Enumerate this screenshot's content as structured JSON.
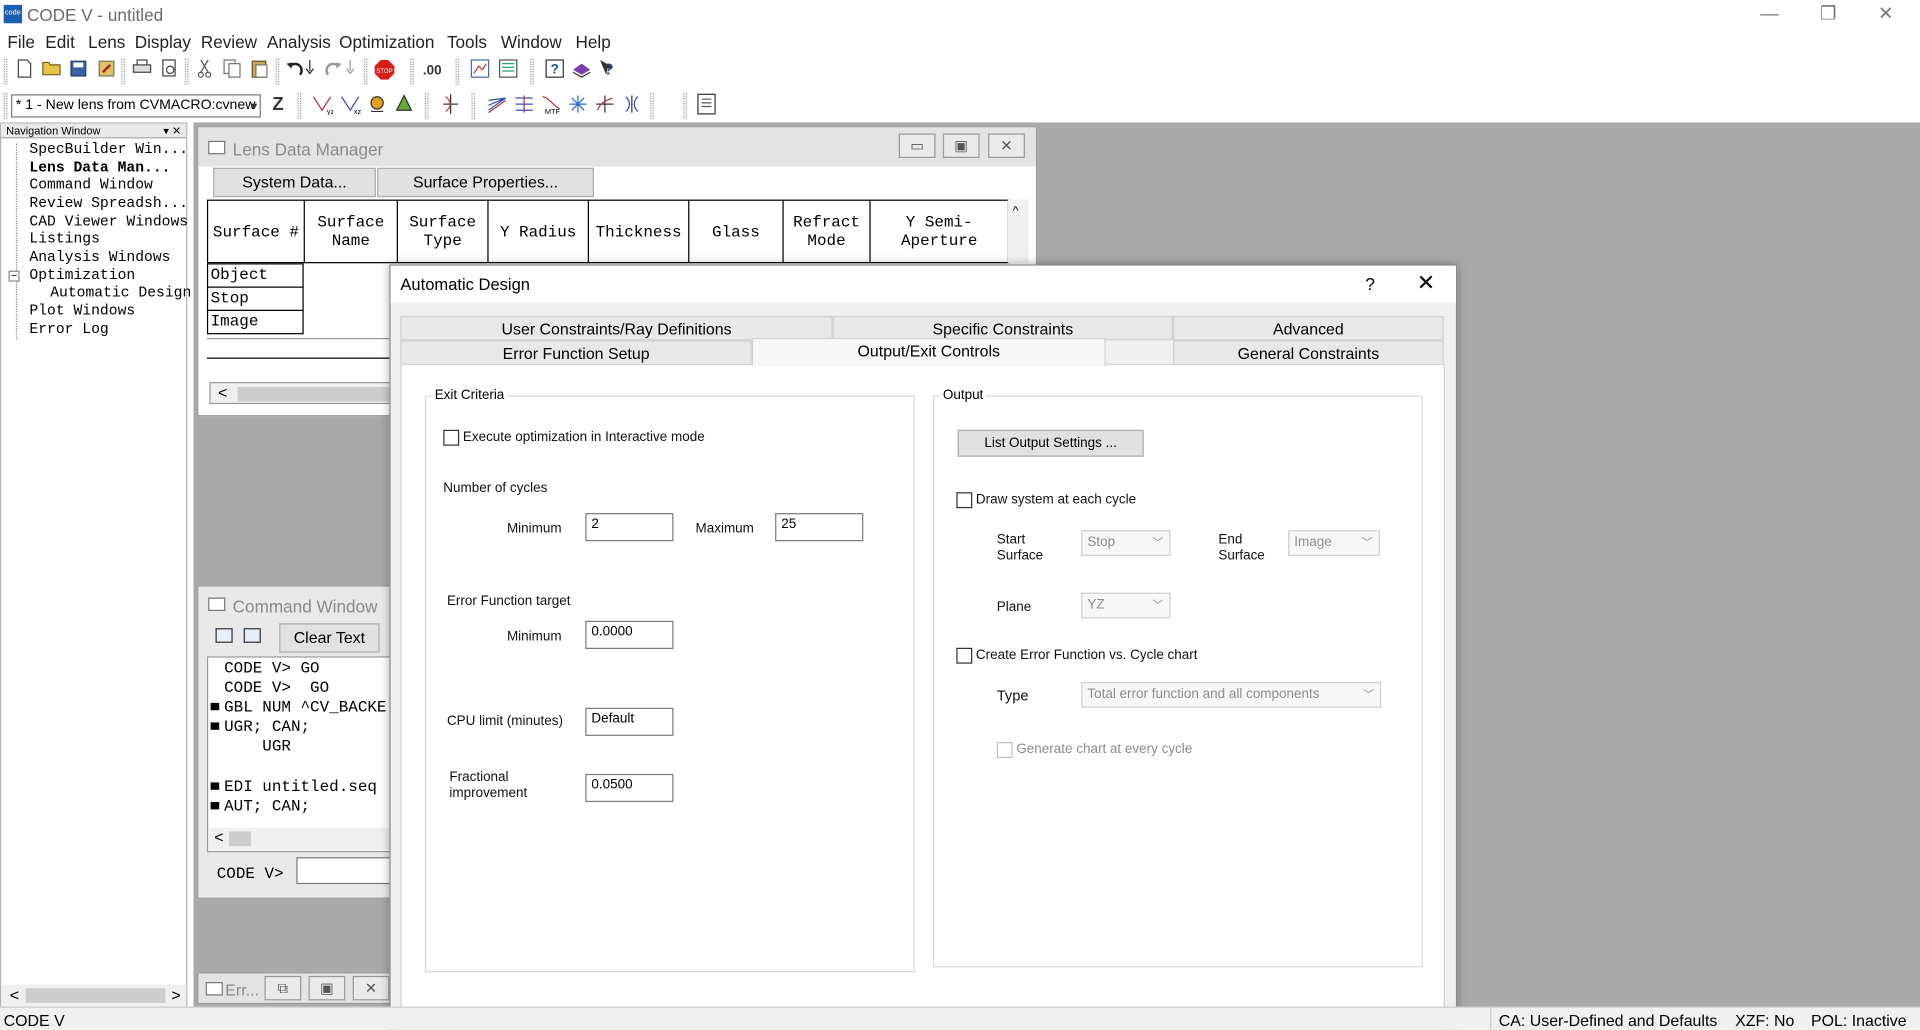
{
  "app": {
    "title": "CODE V - untitled",
    "icon_text": "code",
    "minimize": "—",
    "maximize": "❐",
    "close": "✕"
  },
  "menu": [
    "File",
    "Edit",
    "Lens",
    "Display",
    "Review",
    "Analysis",
    "Optimization",
    "Tools",
    "Window",
    "Help"
  ],
  "toolbar": {
    "lens_combo": "* 1 - New lens from CVMACRO:cvnew",
    "lens_combo_arrow": "▾",
    "z_button": "Z",
    "stop_icon": "STOP",
    "precision": ".00",
    "icons_row1": [
      "new-file-icon",
      "open-folder-icon",
      "save-icon",
      "save-as-icon",
      "print-icon",
      "print-preview-icon",
      "cut-icon",
      "copy-icon",
      "paste-icon",
      "undo-icon",
      "undo-list-icon",
      "redo-icon",
      "redo-list-icon",
      "stop-icon",
      "precision-icon",
      "lens-view-icon",
      "lens-list-icon",
      "help-icon",
      "help-book-icon",
      "context-help-icon"
    ],
    "icons_row2": [
      "yz-fan-icon",
      "xz-fan-icon",
      "spot-icon",
      "ray-icon",
      "field-curve-icon",
      "layout-icon",
      "distortion-icon",
      "mtf-icon",
      "psf-icon",
      "aberration-icon",
      "wave-icon",
      "report-icon"
    ]
  },
  "nav": {
    "title": "Navigation Window",
    "controls": "▾ ✕",
    "items": [
      "SpecBuilder Win...",
      "Lens Data Man...",
      "Command Window",
      "Review Spreadsh...",
      "CAD Viewer Windows",
      "Listings",
      "Analysis Windows",
      "Optimization",
      "Automatic Design",
      "Plot Windows",
      "Error Log"
    ],
    "expander": "−",
    "scroll_left": "<",
    "scroll_right": ">"
  },
  "ldm": {
    "title": "Lens Data Manager",
    "system_data": "System Data...",
    "surface_props": "Surface Properties...",
    "columns": [
      "Surface #",
      "Surface Name",
      "Surface Type",
      "Y Radius",
      "Thickness",
      "Glass",
      "Refract Mode",
      "Y Semi-Aperture"
    ],
    "rows": [
      "Object",
      "Stop",
      "Image"
    ],
    "scroll_left": "<",
    "scroll_up": "^",
    "btn_min": "▭",
    "btn_max": "▣",
    "btn_close": "✕"
  },
  "cmd": {
    "title": "Command Window",
    "clear": "Clear Text",
    "lines": [
      "CODE V> GO",
      "CODE V>  GO",
      "GBL NUM ^CV_BACKE",
      "UGR; CAN;",
      "    UGR",
      "",
      "EDI untitled.seq",
      "AUT; CAN;"
    ],
    "prompt": "CODE V>",
    "scroll_left": "<"
  },
  "err": {
    "title": "Err...",
    "btn_restore": "⧉",
    "btn_max": "▣",
    "btn_close": "✕"
  },
  "dialog": {
    "title": "Automatic Design",
    "help": "?",
    "close": "✕",
    "tabs_row1": [
      "User Constraints/Ray Definitions",
      "Specific Constraints",
      "Advanced"
    ],
    "tabs_row2": [
      "Error Function Setup",
      "Output/Exit Controls",
      "General Constraints"
    ],
    "exit": {
      "group": "Exit Criteria",
      "interactive": "Execute optimization in Interactive mode",
      "cycles_label": "Number of cycles",
      "min_label": "Minimum",
      "min_value": "2",
      "max_label": "Maximum",
      "max_value": "25",
      "ef_label": "Error Function target",
      "ef_min_label": "Minimum",
      "ef_min_value": "0.0000",
      "cpu_label": "CPU limit (minutes)",
      "cpu_value": "Default",
      "frac_label": "Fractional improvement",
      "frac_value": "0.0500"
    },
    "output": {
      "group": "Output",
      "list_btn": "List Output Settings ...",
      "draw": "Draw system at each cycle",
      "start_label": "Start Surface",
      "start_value": "Stop",
      "end_label": "End Surface",
      "end_value": "Image",
      "plane_label": "Plane",
      "plane_value": "YZ",
      "create_chart": "Create Error Function vs. Cycle chart",
      "type_label": "Type",
      "type_value": "Total error function and all components",
      "every_cycle": "Generate chart at every cycle",
      "arrow": "﹀"
    }
  },
  "status": {
    "left": "CODE V",
    "ca": "CA: User-Defined and Defaults",
    "xzf": "XZF: No",
    "pol": "POL: Inactive"
  }
}
